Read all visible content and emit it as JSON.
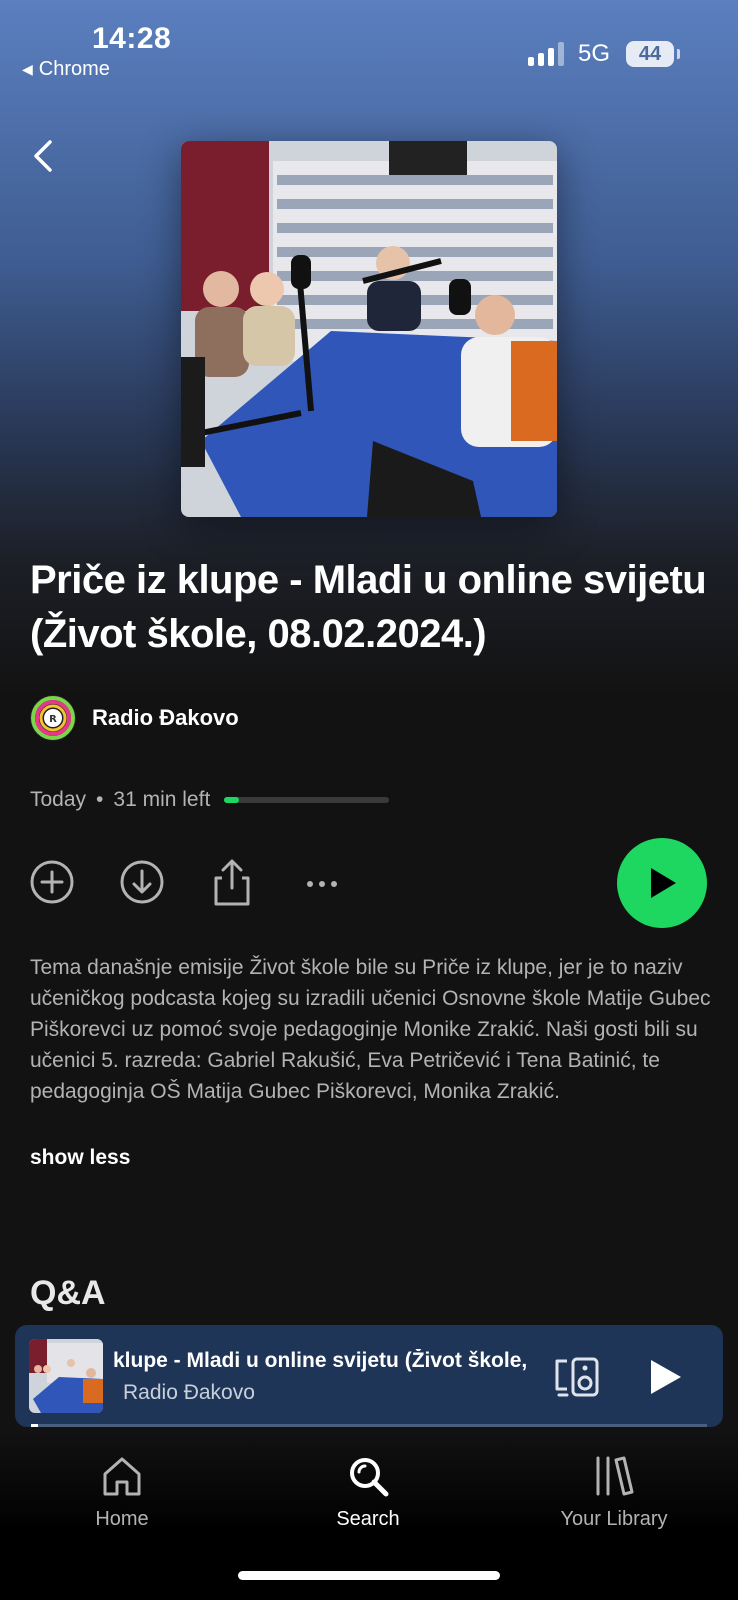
{
  "status_bar": {
    "time": "14:28",
    "back_app": "Chrome",
    "network": "5G",
    "battery": "44"
  },
  "episode": {
    "title": "Priče iz klupe - Mladi u online svijetu (Život škole, 08.02.2024.)",
    "creator": "Radio Đakovo",
    "date": "Today",
    "separator": "•",
    "time_left": "31 min left",
    "progress_fraction": 0.09,
    "description": "Tema današnje emisije Život škole bile su Priče iz klupe, jer je to naziv učeničkog podcasta kojeg su izradili učenici Osnovne škole Matije Gubec Piškorevci uz pomoć svoje pedagoginje Monike Zrakić. Naši gosti bili su učenici 5. razreda: Gabriel Rakušić, Eva Petričević i Tena Batinić, te pedagoginja OŠ Matija Gubec Piškorevci, Monika Zrakić.",
    "show_less": "show less"
  },
  "sections": {
    "qa": "Q&A"
  },
  "mini_player": {
    "title": "klupe - Mladi u online svijetu (Život škole,",
    "artist": "Radio Đakovo",
    "progress_fraction": 0.01
  },
  "tabs": [
    {
      "label": "Home",
      "icon": "home-icon",
      "active": false
    },
    {
      "label": "Search",
      "icon": "search-icon",
      "active": true
    },
    {
      "label": "Your Library",
      "icon": "library-icon",
      "active": false
    }
  ],
  "colors": {
    "accent": "#1ed760",
    "mini_player_bg": "#1f3557",
    "background": "#121212"
  }
}
